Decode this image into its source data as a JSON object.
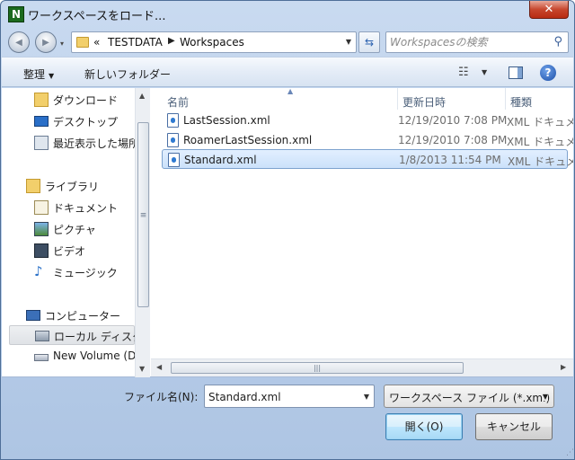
{
  "window": {
    "title": "ワークスペースをロード...",
    "app_icon_letter": "N",
    "close_glyph": "✕"
  },
  "nav": {
    "back_glyph": "◀",
    "forward_glyph": "▶",
    "history_glyph": "▾",
    "breadcrumb_prefix": "«",
    "breadcrumb": [
      "TESTDATA",
      "Workspaces"
    ],
    "breadcrumb_sep": "▶",
    "refresh_glyph": "⇆",
    "search_placeholder": "Workspacesの検索"
  },
  "toolbar": {
    "organize_label": "整理",
    "new_folder_label": "新しいフォルダー"
  },
  "sidebar": {
    "items": [
      {
        "label": "ダウンロード",
        "icon": "download-folder-icon"
      },
      {
        "label": "デスクトップ",
        "icon": "desktop-icon"
      },
      {
        "label": "最近表示した場所",
        "icon": "recent-places-icon"
      },
      {
        "label": "ライブラリ",
        "icon": "library-icon"
      },
      {
        "label": "ドキュメント",
        "icon": "documents-icon"
      },
      {
        "label": "ピクチャ",
        "icon": "pictures-icon"
      },
      {
        "label": "ビデオ",
        "icon": "videos-icon"
      },
      {
        "label": "ミュージック",
        "icon": "music-icon"
      },
      {
        "label": "コンピューター",
        "icon": "computer-icon"
      },
      {
        "label": "ローカル ディスク",
        "icon": "local-disk-icon"
      },
      {
        "label": "New Volume (D",
        "icon": "drive-icon"
      }
    ]
  },
  "file_list": {
    "columns": [
      "名前",
      "更新日時",
      "種類"
    ],
    "rows": [
      {
        "name": "LastSession.xml",
        "date": "12/19/2010 7:08 PM",
        "type": "XML ドキュメント"
      },
      {
        "name": "RoamerLastSession.xml",
        "date": "12/19/2010 7:08 PM",
        "type": "XML ドキュメント"
      },
      {
        "name": "Standard.xml",
        "date": "1/8/2013 11:54 PM",
        "type": "XML ドキュメント",
        "selected": true
      }
    ]
  },
  "bottom": {
    "filename_label": "ファイル名(N):",
    "filename_value": "Standard.xml",
    "filetype_value": "ワークスペース ファイル (*.xml)",
    "open_label": "開く(O)",
    "cancel_label": "キャンセル"
  },
  "colors": {
    "selection": "#cbe1fa",
    "frame": "#b7cde9",
    "close": "#c7472e"
  }
}
